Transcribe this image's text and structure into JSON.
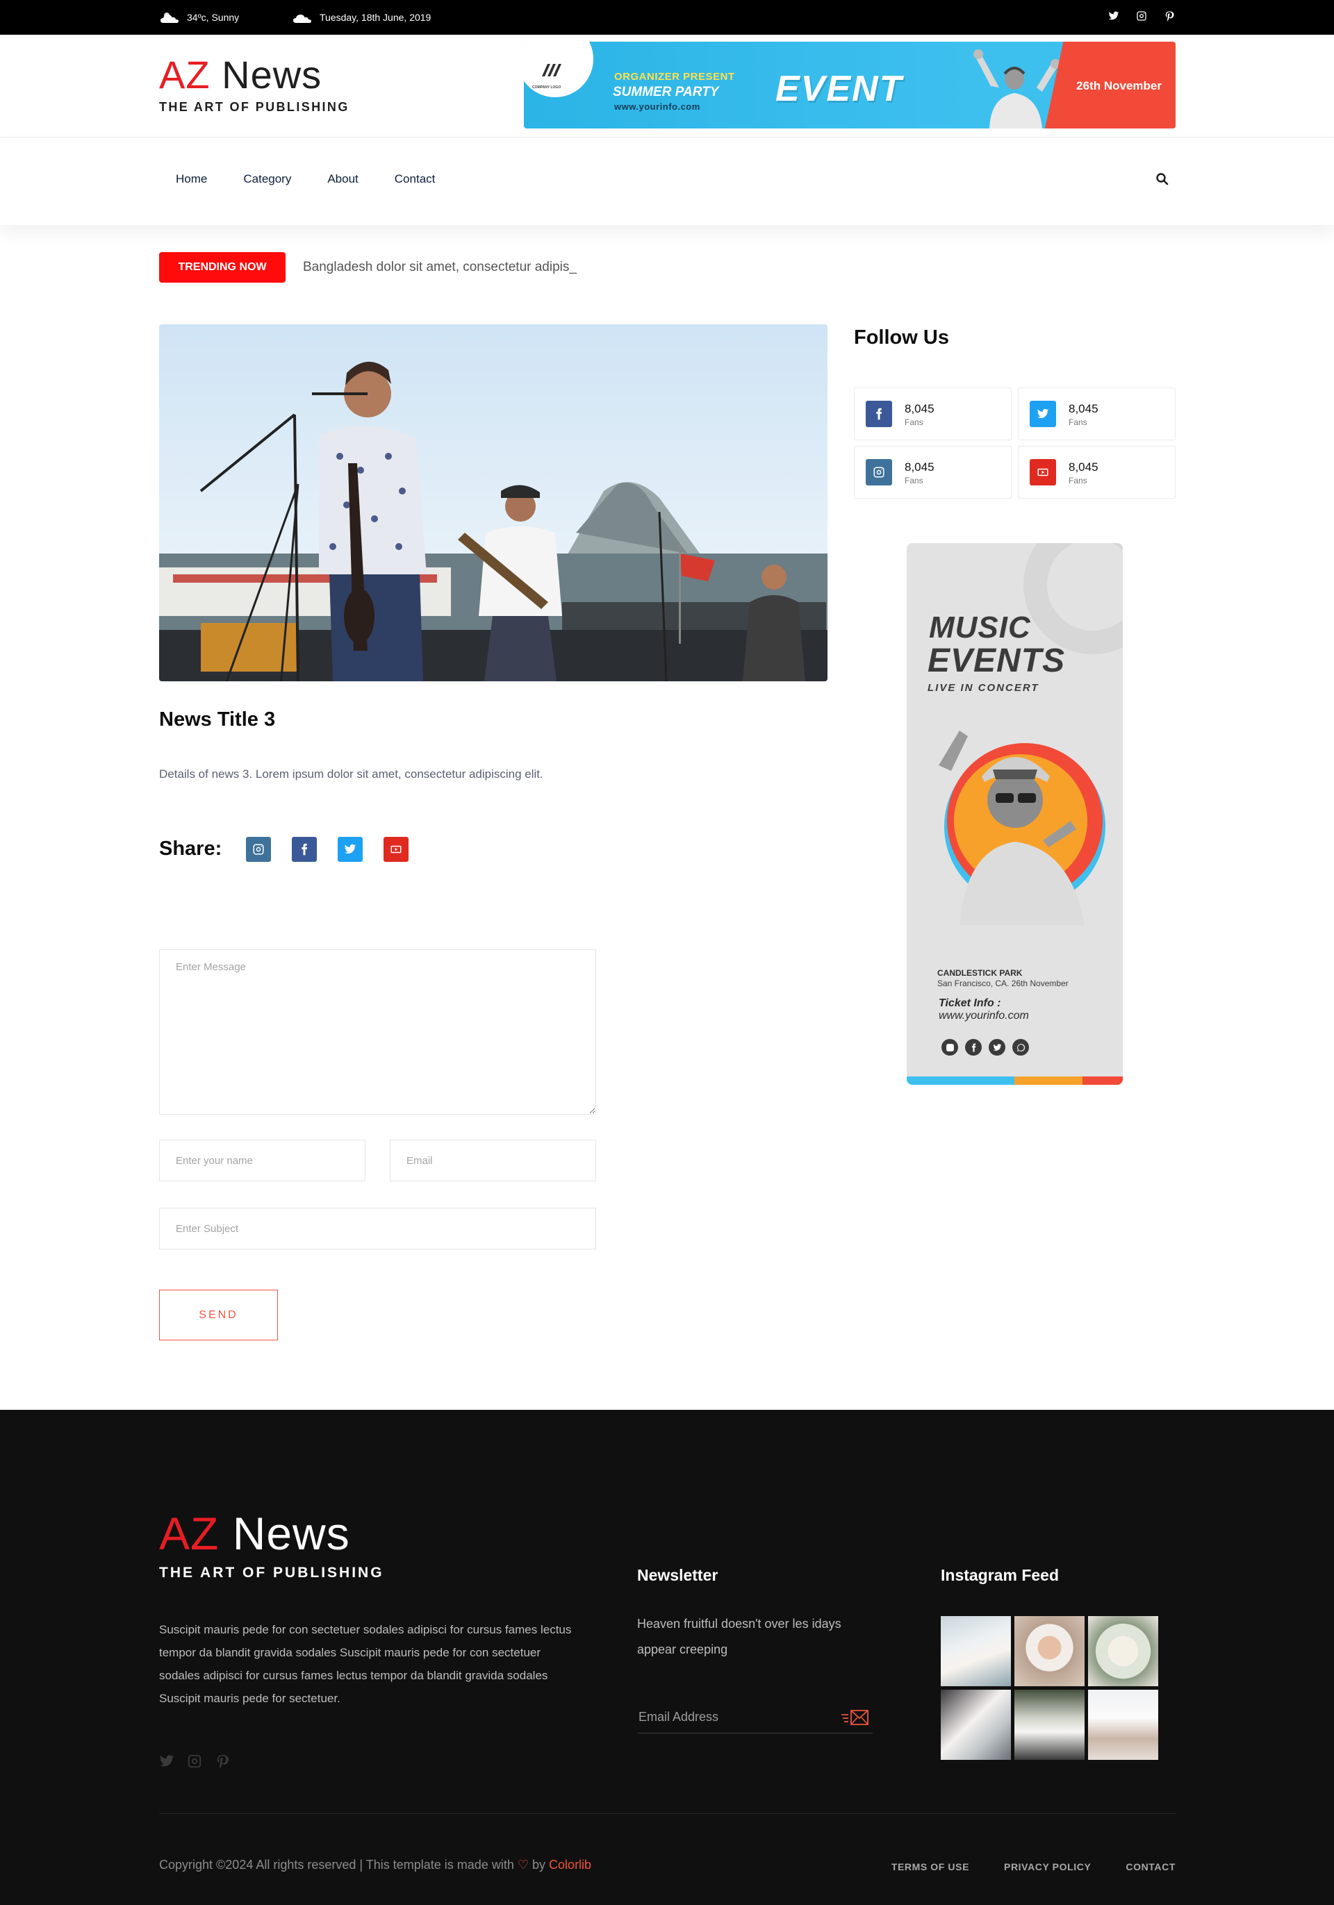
{
  "topbar": {
    "weather": "34ºc, Sunny",
    "date": "Tuesday, 18th June, 2019",
    "social_icons": [
      "twitter-icon",
      "instagram-icon",
      "pinterest-icon"
    ]
  },
  "logo": {
    "az": "AZ",
    "news": "News",
    "tagline": "THE ART OF PUBLISHING"
  },
  "banner": {
    "company": "COMPANY LOGO",
    "organizer": "ORGANIZER PRESENT",
    "party": "SUMMER PARTY",
    "url": "www.yourinfo.com",
    "event": "EVENT",
    "date": "26th November"
  },
  "nav": {
    "items": [
      {
        "label": "Home"
      },
      {
        "label": "Category"
      },
      {
        "label": "About"
      },
      {
        "label": "Contact"
      }
    ]
  },
  "trending": {
    "badge": "TRENDING NOW",
    "text": "Bangladesh dolor sit amet, consectetur adipis_"
  },
  "article": {
    "title": "News Title 3",
    "body": "Details of news 3. Lorem ipsum dolor sit amet, consectetur adipiscing elit.",
    "share_label": "Share:"
  },
  "form": {
    "message_placeholder": "Enter Message",
    "name_placeholder": "Enter your name",
    "email_placeholder": "Email",
    "subject_placeholder": "Enter Subject",
    "send_label": "SEND"
  },
  "sidebar": {
    "follow_title": "Follow Us",
    "cards": [
      {
        "network": "facebook",
        "icon": "facebook-icon",
        "color": "#3b5998",
        "count": "8,045",
        "label": "Fans"
      },
      {
        "network": "twitter",
        "icon": "twitter-icon",
        "color": "#1da1f2",
        "count": "8,045",
        "label": "Fans"
      },
      {
        "network": "instagram",
        "icon": "instagram-icon",
        "color": "#3f729b",
        "count": "8,045",
        "label": "Fans"
      },
      {
        "network": "youtube",
        "icon": "youtube-icon",
        "color": "#e02a20",
        "count": "8,045",
        "label": "Fans"
      }
    ],
    "poster": {
      "line1": "MUSIC",
      "line2": "EVENTS",
      "line3": "LIVE IN CONCERT",
      "venue": "CANDLESTICK PARK",
      "address": "San Francisco, CA. 26th November",
      "ticket": "Ticket Info :",
      "url": "www.yourinfo.com"
    }
  },
  "footer": {
    "about": "Suscipit mauris pede for con sectetuer sodales adipisci for cursus fames lectus tempor da blandit gravida sodales Suscipit mauris pede for con sectetuer sodales adipisci for cursus fames lectus tempor da blandit gravida sodales Suscipit mauris pede for sectetuer.",
    "newsletter_title": "Newsletter",
    "newsletter_text": "Heaven fruitful doesn't over les idays appear creeping",
    "email_placeholder": "Email Address",
    "instagram_title": "Instagram Feed",
    "copyright_prefix": "Copyright ©2024 All rights reserved | This template is made with",
    "copyright_by": "by",
    "copyright_brand": "Colorlib",
    "links": [
      "TERMS OF USE",
      "PRIVACY POLICY",
      "CONTACT"
    ]
  },
  "colors": {
    "accent_red": "#e81d23",
    "trending_red": "#ff0b0b",
    "send_orange": "#f0543e",
    "footer_bg": "#101010",
    "banner_blue": "#3ec0ef"
  }
}
